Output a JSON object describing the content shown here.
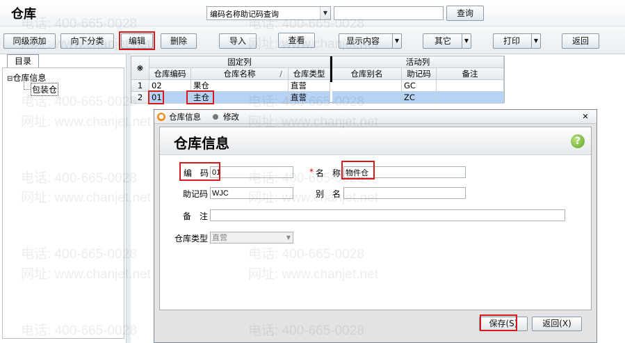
{
  "app": {
    "title": "仓库"
  },
  "search": {
    "mode": "编码名称助记码查询",
    "value": "",
    "query_label": "查询"
  },
  "toolbar": {
    "add_same_level": "同级添加",
    "add_sub_category": "向下分类",
    "edit": "编辑",
    "delete": "删除",
    "import": "导入",
    "view": "查看",
    "display_content": "显示内容",
    "other": "其它",
    "print": "打印",
    "back": "返回"
  },
  "left_panel": {
    "tab": "目录",
    "tree": {
      "root": "仓库信息",
      "child": "包装仓"
    }
  },
  "grid": {
    "group_fixed": "固定列",
    "group_active": "活动列",
    "corner": "❋",
    "columns": [
      "仓库编码",
      "仓库名称",
      "仓库类型",
      "仓库别名",
      "助记码",
      "备注"
    ],
    "sort_mark": "/",
    "rows": [
      {
        "no": "1",
        "code": "02",
        "name": "果仓",
        "type": "直营",
        "alias": "",
        "mnemonic": "GC",
        "remark": ""
      },
      {
        "no": "2",
        "code": "01",
        "name": "主仓",
        "type": "直营",
        "alias": "",
        "mnemonic": "ZC",
        "remark": ""
      }
    ]
  },
  "dialog": {
    "title": "仓库信息",
    "mode": "修改",
    "heading": "仓库信息",
    "fields": {
      "code_label": "编　码",
      "code_value": "01",
      "name_required_mark": "*",
      "name_label": "名　称",
      "name_value": "物件仓",
      "mnemonic_label": "助记码",
      "mnemonic_value": "WJC",
      "alias_label": "别　名",
      "alias_value": "",
      "remark_label": "备　注",
      "remark_value": "",
      "type_label": "仓库类型",
      "type_value": "直营"
    },
    "save_label": "保存(S)",
    "back_label": "返回(X)"
  },
  "watermark": {
    "phone": "电话: 400-665-0028",
    "site": "网址: www.chanjet.net"
  },
  "icons": {
    "help": "help-icon",
    "close": "close-icon",
    "dialog": "dialog-icon"
  },
  "colors": {
    "highlight": "#d61a1a",
    "selected_row": "#b6d3f5"
  }
}
